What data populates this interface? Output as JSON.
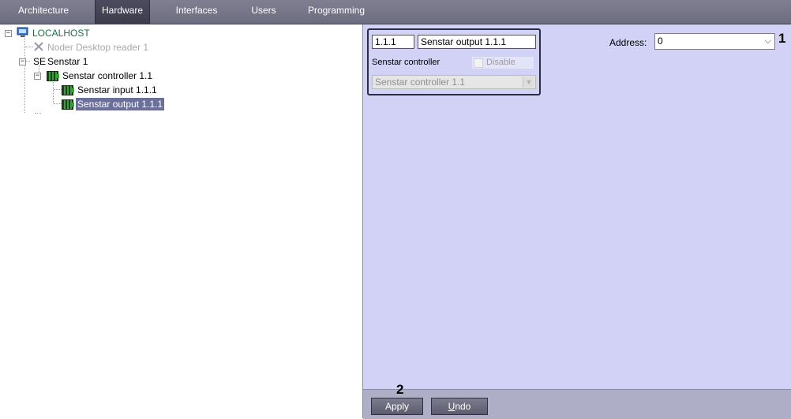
{
  "tabs": [
    {
      "label": "Architecture"
    },
    {
      "label": "Hardware"
    },
    {
      "label": "Interfaces"
    },
    {
      "label": "Users"
    },
    {
      "label": "Programming"
    }
  ],
  "tree": {
    "root": "LOCALHOST",
    "reader": "Noder Desktop reader 1",
    "senstar_prefix": "SE",
    "senstar": "Senstar 1",
    "controller": "Senstar controller 1.1",
    "input": "Senstar input 1.1.1",
    "output": "Senstar output 1.1.1"
  },
  "object_panel": {
    "id": "1.1.1",
    "name": "Senstar output 1.1.1",
    "type_label": "Senstar controller",
    "disable_label": "Disable",
    "parent_value": "Senstar controller 1.1"
  },
  "address": {
    "label": "Address:",
    "value": "0"
  },
  "buttons": {
    "apply": "Apply",
    "undo_u": "U",
    "undo_rest": "ndo"
  },
  "callouts": {
    "one": "1",
    "two": "2"
  },
  "colors": {
    "tabbar": "#75758a",
    "active_tab": "#44445a",
    "panel": "#d2d2f7",
    "selection": "#6a6f9b",
    "tree_root": "#1e6b4a"
  }
}
